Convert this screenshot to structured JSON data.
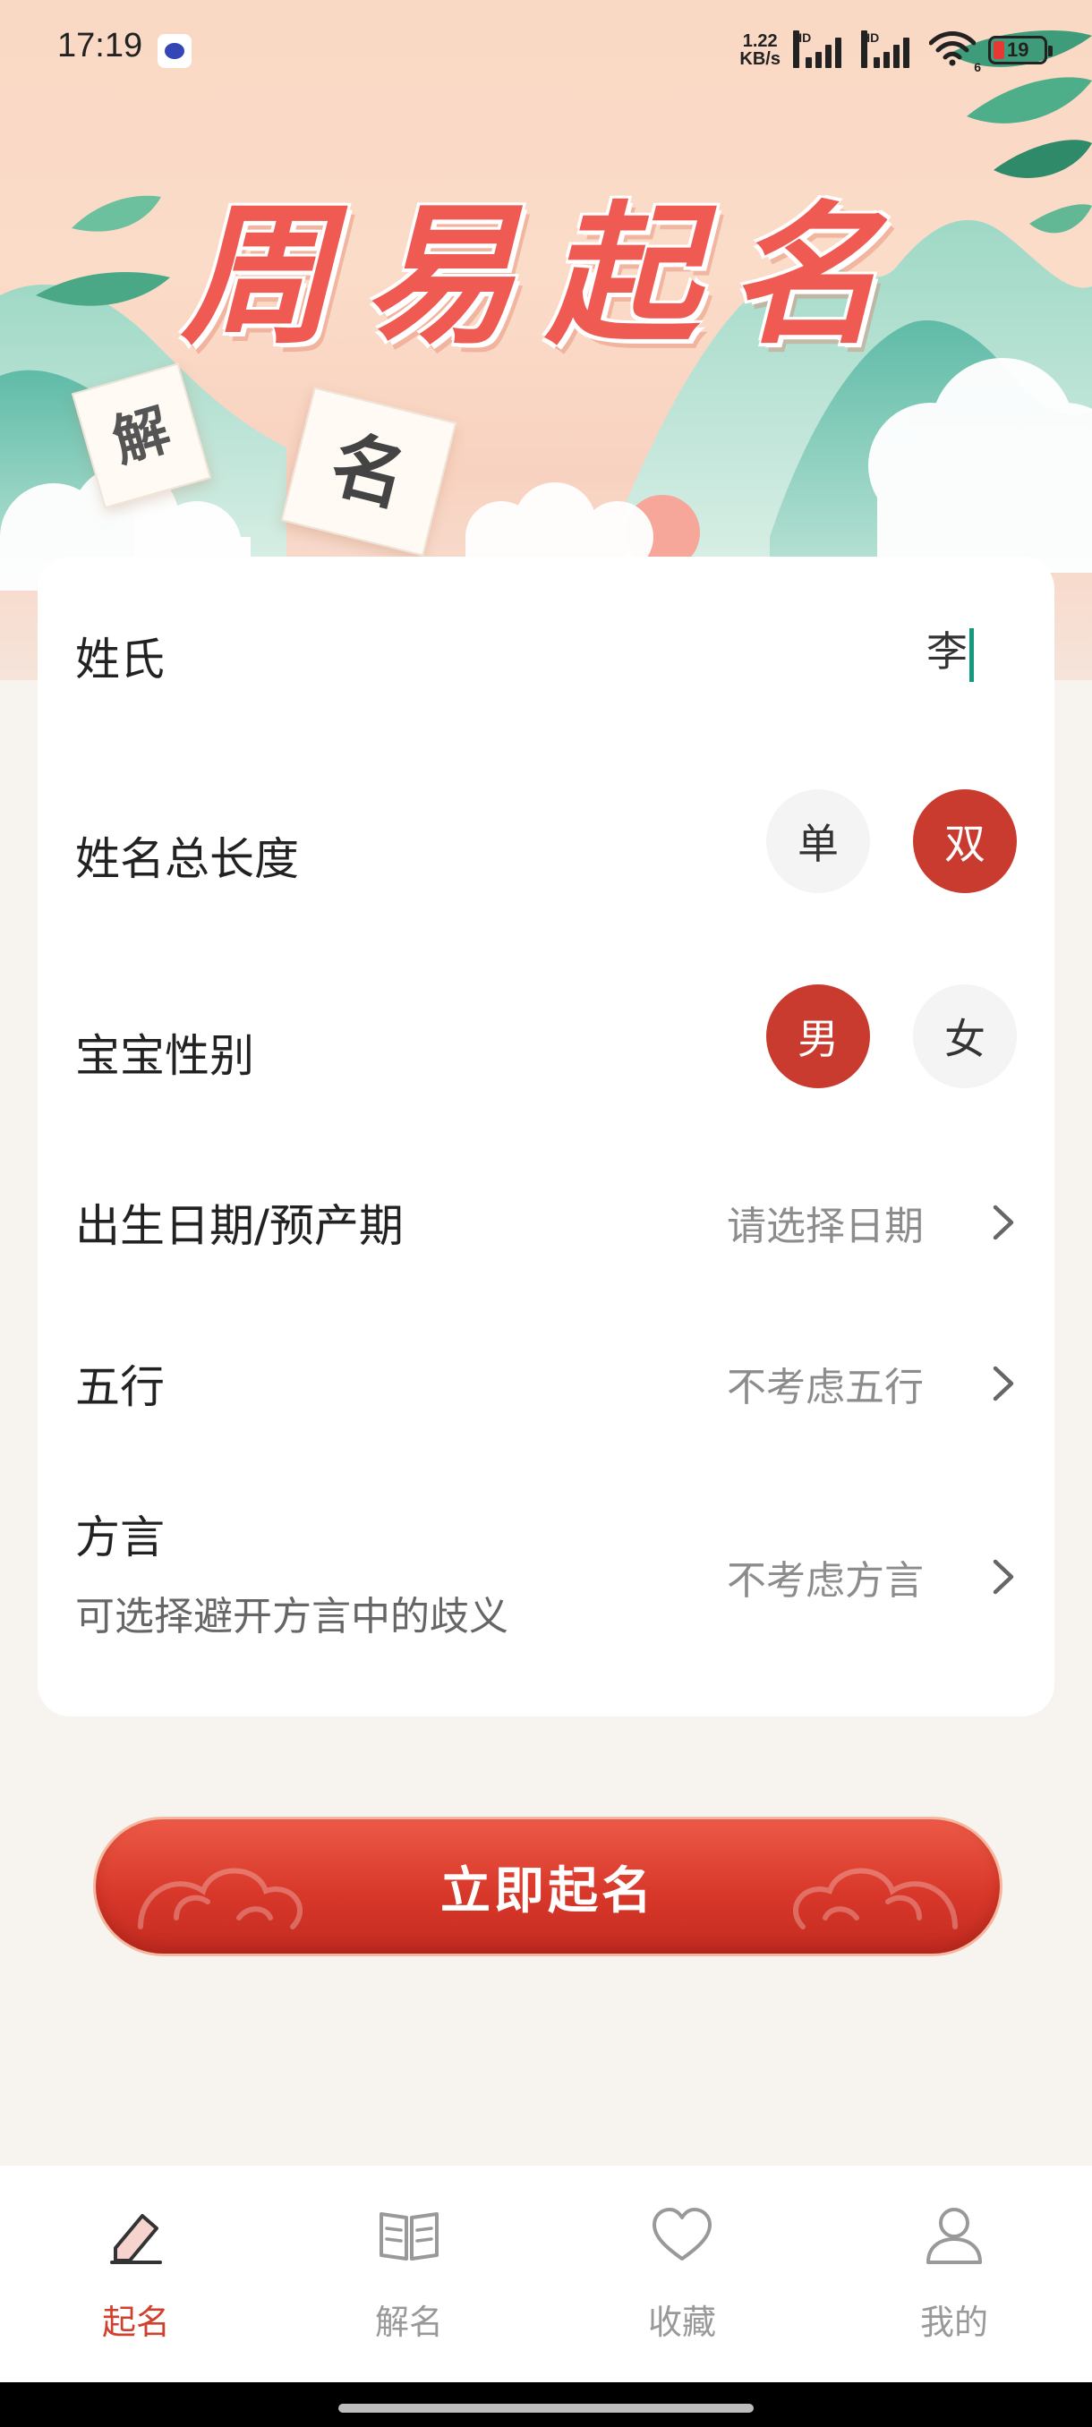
{
  "status_bar": {
    "time": "17:19",
    "net_speed_value": "1.22",
    "net_speed_unit": "KB/s",
    "hd1": "HD",
    "hd2": "HD",
    "wifi_badge": "6",
    "battery": "19"
  },
  "hero": {
    "title": "周易起名",
    "paper_left": "解",
    "paper_right": "名"
  },
  "form": {
    "surname": {
      "label": "姓氏",
      "value": "李"
    },
    "name_length": {
      "label": "姓名总长度",
      "options": [
        "单",
        "双"
      ],
      "selected": "双"
    },
    "gender": {
      "label": "宝宝性别",
      "options": [
        "男",
        "女"
      ],
      "selected": "男"
    },
    "birth_date": {
      "label": "出生日期/预产期",
      "placeholder": "请选择日期"
    },
    "five_elements": {
      "label": "五行",
      "value": "不考虑五行"
    },
    "dialect": {
      "label": "方言",
      "sublabel": "可选择避开方言中的歧义",
      "value": "不考虑方言"
    }
  },
  "cta": {
    "label": "立即起名"
  },
  "bottom_nav": {
    "items": [
      {
        "label": "起名",
        "icon": "pencil-icon",
        "active": true
      },
      {
        "label": "解名",
        "icon": "book-icon",
        "active": false
      },
      {
        "label": "收藏",
        "icon": "heart-icon",
        "active": false
      },
      {
        "label": "我的",
        "icon": "user-icon",
        "active": false
      }
    ]
  },
  "colors": {
    "accent": "#c93b2e",
    "title_red": "#ef5a52",
    "caret_green": "#159a7d",
    "page_bg": "#f7f3ef"
  }
}
